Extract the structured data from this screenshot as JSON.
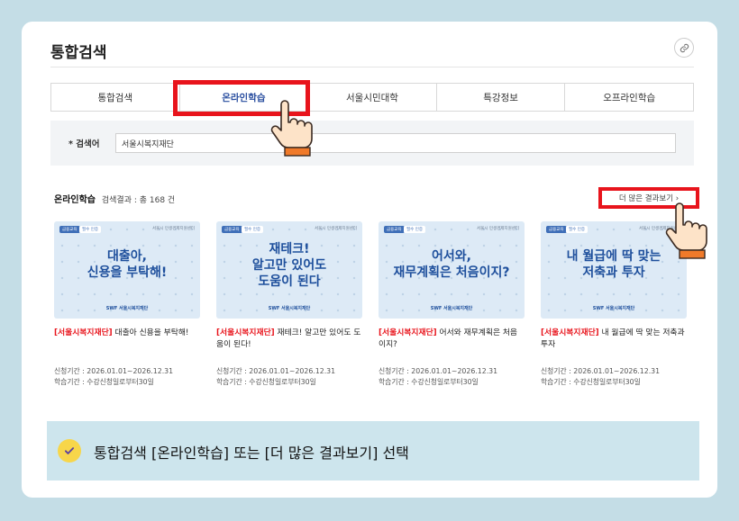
{
  "page": {
    "title": "통합검색"
  },
  "tabs": [
    {
      "label": "통합검색",
      "active": false
    },
    {
      "label": "온라인학습",
      "active": true
    },
    {
      "label": "서울시민대학",
      "active": false
    },
    {
      "label": "특강정보",
      "active": false
    },
    {
      "label": "오프라인학습",
      "active": false
    }
  ],
  "search": {
    "label": "* 검색어",
    "value": "서울시복지재단"
  },
  "results": {
    "label": "온라인학습",
    "count_text": "검색결과 : 총 168 건",
    "more_label": "더 많은 결과보기 ›"
  },
  "cards": [
    {
      "badge1": "금융교육",
      "badge2": "필수 인증",
      "org": "서울시 민생경제지원센터",
      "thumb_line1": "대출아,",
      "thumb_line2": "신용을 부탁해!",
      "logo": "SWF 서울시복지재단",
      "org_tag": "[서울시복지재단]",
      "title": " 대출아 신용을 부탁해!",
      "apply_period": "신청기간 : 2026.01.01~2026.12.31",
      "study_period": "학습기간 : 수강신청일로부터30일"
    },
    {
      "badge1": "금융교육",
      "badge2": "필수 인증",
      "org": "서울시 민생경제지원센터",
      "thumb_line1": "재테크!",
      "thumb_line2": "알고만 있어도",
      "thumb_line3": "도움이 된다",
      "logo": "SWF 서울시복지재단",
      "org_tag": "[서울시복지재단]",
      "title": " 재테크! 알고만 있어도 도움이 된다!",
      "apply_period": "신청기간 : 2026.01.01~2026.12.31",
      "study_period": "학습기간 : 수강신청일로부터30일"
    },
    {
      "badge1": "금융교육",
      "badge2": "필수 인증",
      "org": "서울시 민생경제지원센터",
      "thumb_line1": "어서와,",
      "thumb_line2": "재무계획은 처음이지?",
      "logo": "SWF 서울시복지재단",
      "org_tag": "[서울시복지재단]",
      "title": " 어서와 재무계획은 처음이지?",
      "apply_period": "신청기간 : 2026.01.01~2026.12.31",
      "study_period": "학습기간 : 수강신청일로부터30일"
    },
    {
      "badge1": "금융교육",
      "badge2": "필수 인증",
      "org": "서울시 민생경제지원센터",
      "thumb_line1": "내 월급에 딱 맞는",
      "thumb_line2": "저축과 투자",
      "logo": "SWF 서울시복지재단",
      "org_tag": "[서울시복지재단]",
      "title": " 내 월급에 딱 맞는 저축과 투자",
      "apply_period": "신청기간 : 2026.01.01~2026.12.31",
      "study_period": "학습기간 : 수강신청일로부터30일"
    }
  ],
  "footer": {
    "instruction": "통합검색 [온라인학습] 또는 [더 많은 결과보기] 선택"
  },
  "colors": {
    "highlight": "#e8141c",
    "accent": "#2b4fa0",
    "thumb_bg": "#ddeaf6",
    "check": "#f7d64a"
  }
}
